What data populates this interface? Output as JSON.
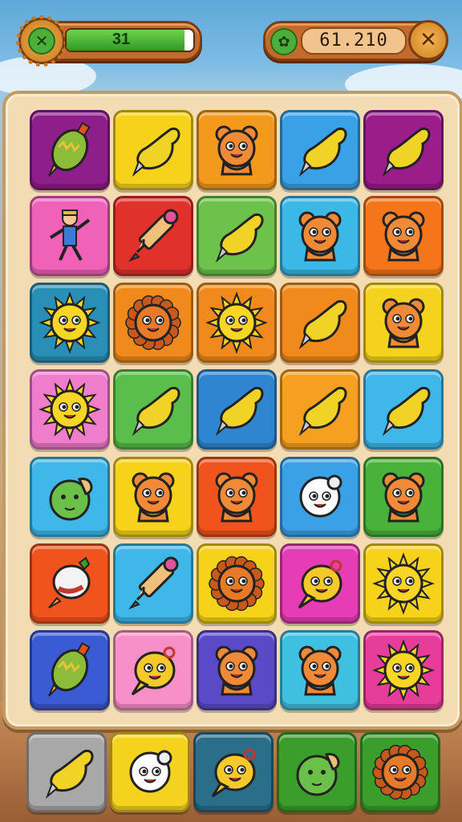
{
  "hud": {
    "level_icon": "x-icon",
    "progress_value": "31",
    "progress_fraction": 0.93,
    "coin_icon": "leaf-coin-icon",
    "score": "61.210",
    "close_icon": "x-icon"
  },
  "board": {
    "rows": [
      [
        {
          "item": "squash",
          "color": "#8e1e8a"
        },
        {
          "item": "pear",
          "color": "#f7d21a"
        },
        {
          "item": "bear",
          "color": "#f39a1c"
        },
        {
          "item": "pear",
          "color": "#3aa1e6"
        },
        {
          "item": "pear",
          "color": "#9a1d8a"
        }
      ],
      [
        {
          "item": "figure",
          "color": "#f061b8"
        },
        {
          "item": "pencil",
          "color": "#e0312a"
        },
        {
          "item": "pear",
          "color": "#6cc24a"
        },
        {
          "item": "bear",
          "color": "#3cb8e6"
        },
        {
          "item": "bear",
          "color": "#f5751a"
        }
      ],
      [
        {
          "item": "sun",
          "color": "#2a8fb6"
        },
        {
          "item": "lion",
          "color": "#f08a1c"
        },
        {
          "item": "sun",
          "color": "#f08a1c"
        },
        {
          "item": "pear",
          "color": "#f08a1c"
        },
        {
          "item": "bear",
          "color": "#f5d21e"
        }
      ],
      [
        {
          "item": "sun",
          "color": "#f07ccc"
        },
        {
          "item": "pear",
          "color": "#5abf4a"
        },
        {
          "item": "pear",
          "color": "#2f86d0"
        },
        {
          "item": "pear",
          "color": "#f5a020"
        },
        {
          "item": "pear",
          "color": "#3fb7e8"
        }
      ],
      [
        {
          "item": "fish",
          "color": "#3fb7e8"
        },
        {
          "item": "bear",
          "color": "#f7d21a"
        },
        {
          "item": "bear",
          "color": "#f0541c"
        },
        {
          "item": "bulb",
          "color": "#3aa1e6"
        },
        {
          "item": "bear",
          "color": "#48b23a"
        }
      ],
      [
        {
          "item": "carrot",
          "color": "#f0541c"
        },
        {
          "item": "pencil",
          "color": "#3fb7e8"
        },
        {
          "item": "lion",
          "color": "#f7d21a"
        },
        {
          "item": "bubble",
          "color": "#e63cb4"
        },
        {
          "item": "sun",
          "color": "#f7d21a"
        }
      ],
      [
        {
          "item": "squash",
          "color": "#3a5bd4"
        },
        {
          "item": "bubble",
          "color": "#f790c8"
        },
        {
          "item": "bear",
          "color": "#5a4ac8"
        },
        {
          "item": "bear",
          "color": "#3fc0e0"
        },
        {
          "item": "sun",
          "color": "#e63c9a"
        }
      ]
    ]
  },
  "tray": [
    {
      "item": "pear",
      "color": "#a8a8a8"
    },
    {
      "item": "bulb",
      "color": "#f5d21e"
    },
    {
      "item": "bubble",
      "color": "#2a6e8a"
    },
    {
      "item": "fish",
      "color": "#3a9e2a"
    },
    {
      "item": "lion",
      "color": "#3a9e2a"
    }
  ],
  "palette": {
    "pear": "#f0d326",
    "bear": "#f08a36",
    "sun": "#f7d626",
    "squash": "#8cbd3a",
    "pencil": "#f0c07a",
    "figure": "#3b7bd6",
    "lion": "#e77a28",
    "fish": "#6bc04a",
    "carrot": "#f4f4f4",
    "bulb": "#ffffff",
    "bubble": "#f5c92a"
  }
}
